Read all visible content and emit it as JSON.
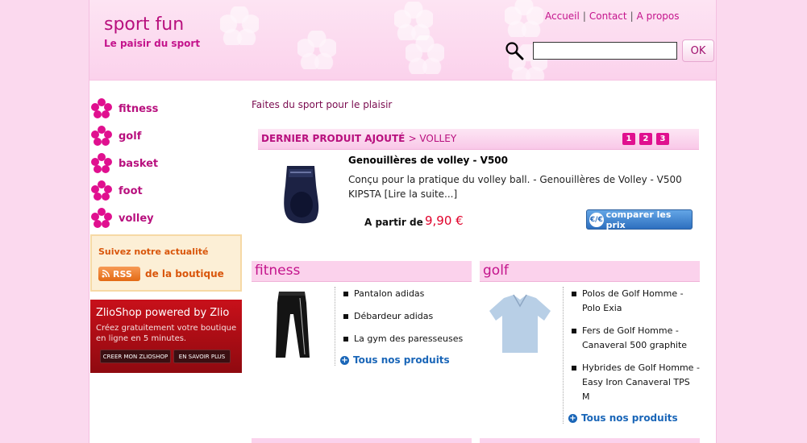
{
  "header": {
    "site_title": "sport fun",
    "tagline": "Le paisir du sport",
    "nav": [
      "Accueil",
      "Contact",
      "A propos"
    ],
    "search": {
      "value": "",
      "button_label": "OK"
    }
  },
  "sidebar": {
    "categories": [
      "fitness",
      "golf",
      "basket",
      "foot",
      "volley"
    ],
    "news": {
      "title": "Suivez notre actualité",
      "rss_label": "RSS",
      "boutique_text": "de la boutique"
    },
    "zlio": {
      "title": "ZlioShop powered by Zlio",
      "text": "Créez gratuitement votre boutique en ligne en 5 minutes.",
      "create_label": "CREER MON ZLIOSHOP",
      "learn_label": "EN SAVOIR PLUS"
    }
  },
  "main": {
    "intro": "Faites du sport pour le plaisir",
    "latest": {
      "bar_title": "DERNIER PRODUIT AJOUTÉ",
      "bar_sub": "> VOLLEY",
      "pages": [
        "1",
        "2",
        "3"
      ],
      "name": "Genouillères de volley - V500",
      "description": "Conçu pour la pratique du volley ball. - Genouillères de Volley - V500 KIPSTA [Lire la suite...]",
      "price_label": "A partir de",
      "price": "9,90 €",
      "compare_label": "comparer les prix",
      "compare_icon": "€/€"
    },
    "categories": [
      {
        "title": "fitness",
        "items": [
          "Pantalon adidas",
          "Débardeur adidas",
          "La gym des paresseuses"
        ],
        "all_label": "Tous nos produits"
      },
      {
        "title": "golf",
        "items": [
          "Polos de Golf Homme - Polo Exia",
          "Fers de Golf Homme - Canaveral 500 graphite",
          "Hybrides de Golf Homme - Easy Iron Canaveral TPS M"
        ],
        "all_label": "Tous nos produits"
      }
    ]
  },
  "colors": {
    "accent": "#c4148c",
    "price": "#e0002a",
    "link": "#1a66b8"
  }
}
